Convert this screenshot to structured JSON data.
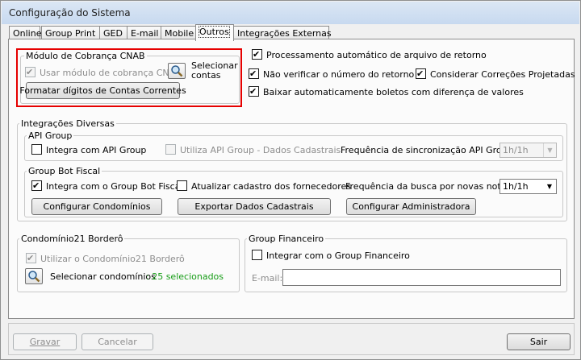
{
  "window": {
    "title": "Configuração do Sistema"
  },
  "tabs": [
    "Online",
    "Group Print",
    "GED",
    "E-mail",
    "Mobile",
    "Outros",
    "Integrações Externas"
  ],
  "cnab": {
    "legend": "Módulo de Cobrança CNAB",
    "use_label": "Usar módulo de cobrança CNAB",
    "select_line1": "Selecionar",
    "select_line2": "contas",
    "format_button": "Formatar dígitos de Contas Correntes"
  },
  "retorno": {
    "auto_process": "Processamento automático de arquivo de retorno",
    "no_verify": "Não verificar o número do retorno",
    "consider": "Considerar Correções Projetadas",
    "download": "Baixar automaticamente boletos com diferença de valores"
  },
  "integracoes": {
    "legend": "Integrações Diversas",
    "api_group": {
      "legend": "API Group",
      "integrate": "Integra com API Group",
      "use_data": "Utiliza API Group - Dados Cadastrais",
      "freq_label": "Frequência de sincronização API Group:",
      "freq_value": "1h/1h"
    },
    "bot_fiscal": {
      "legend": "Group Bot Fiscal",
      "integrate": "Integra com o Group Bot Fiscal",
      "update": "Atualizar cadastro dos fornecedores",
      "freq_label": "Frequência da busca por novas notas:",
      "freq_value": "1h/1h",
      "btn_condominios": "Configurar Condomínios",
      "btn_exportar": "Exportar Dados Cadastrais",
      "btn_admin": "Configurar Administradora"
    }
  },
  "bordero": {
    "legend": "Condomínio21 Borderô",
    "use_label": "Utilizar o Condomínio21 Borderô",
    "select_label": "Selecionar condomínios",
    "selected_count": ": 25 selecionados"
  },
  "financeiro": {
    "legend": "Group Financeiro",
    "integrate": "Integrar com o Group Financeiro",
    "email_label": "E-mail:",
    "email_value": ""
  },
  "footer": {
    "save": "Gravar",
    "cancel": "Cancelar",
    "exit": "Sair"
  }
}
